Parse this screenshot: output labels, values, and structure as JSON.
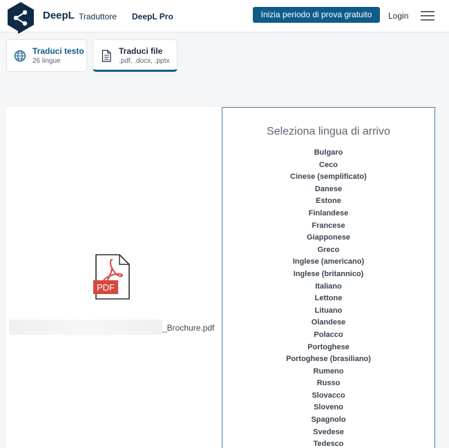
{
  "header": {
    "brand": "DeepL",
    "brand_sub": "Traduttore",
    "pro": "DeepL Pro",
    "trial": "Inizia periodo di prova gratuito",
    "login": "Login"
  },
  "tabs": [
    {
      "title": "Traduci testo",
      "sub": "26 lingue"
    },
    {
      "title": "Traduci file",
      "sub": ".pdf, .docx, .pptx"
    }
  ],
  "file": {
    "icon_label": "PDF",
    "name": "_Brochure.pdf"
  },
  "target": {
    "title": "Seleziona lingua di arrivo",
    "languages": [
      "Bulgaro",
      "Ceco",
      "Cinese (semplificato)",
      "Danese",
      "Estone",
      "Finlandese",
      "Francese",
      "Giapponese",
      "Greco",
      "Inglese (americano)",
      "Inglese (britannico)",
      "Italiano",
      "Lettone",
      "Lituano",
      "Olandese",
      "Polacco",
      "Portoghese",
      "Portoghese (brasiliano)",
      "Rumeno",
      "Russo",
      "Slovacco",
      "Sloveno",
      "Spagnolo",
      "Svedese",
      "Tedesco"
    ]
  },
  "colors": {
    "brand_dark": "#0f2b46",
    "accent": "#0f5c8a",
    "pdf_red": "#d9473e"
  }
}
